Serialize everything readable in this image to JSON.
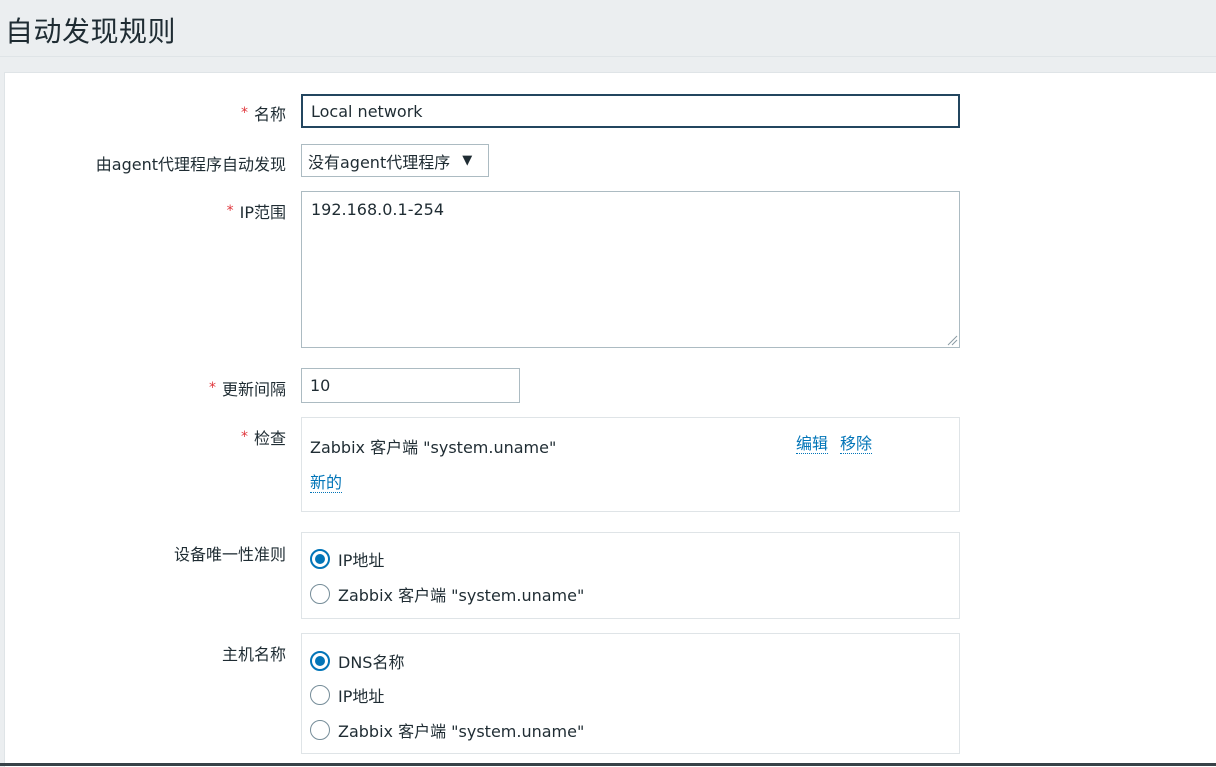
{
  "header": {
    "title": "自动发现规则"
  },
  "form": {
    "name": {
      "label": "名称",
      "value": "Local network",
      "required": true
    },
    "proxy": {
      "label": "由agent代理程序自动发现",
      "selected": "没有agent代理程序"
    },
    "ip_range": {
      "label": "IP范围",
      "value": "192.168.0.1-254",
      "required": true
    },
    "delay": {
      "label": "更新间隔",
      "value": "10",
      "required": true
    },
    "checks": {
      "label": "检查",
      "required": true,
      "items": [
        {
          "text": "Zabbix 客户端 \"system.uname\"",
          "edit": "编辑",
          "remove": "移除"
        }
      ],
      "new_link": "新的"
    },
    "uniqueness": {
      "label": "设备唯一性准则",
      "options": [
        "IP地址",
        "Zabbix 客户端 \"system.uname\""
      ],
      "selected_index": 0
    },
    "host_name": {
      "label": "主机名称",
      "options": [
        "DNS名称",
        "IP地址",
        "Zabbix 客户端 \"system.uname\""
      ],
      "selected_index": 0
    }
  },
  "required_mark": "*",
  "icons": {
    "dropdown": "triangle-down-icon",
    "resize": "resize-grip-icon"
  },
  "colors": {
    "link": "#0275b8",
    "required": "#e0353b",
    "focus_border": "#23465f"
  }
}
